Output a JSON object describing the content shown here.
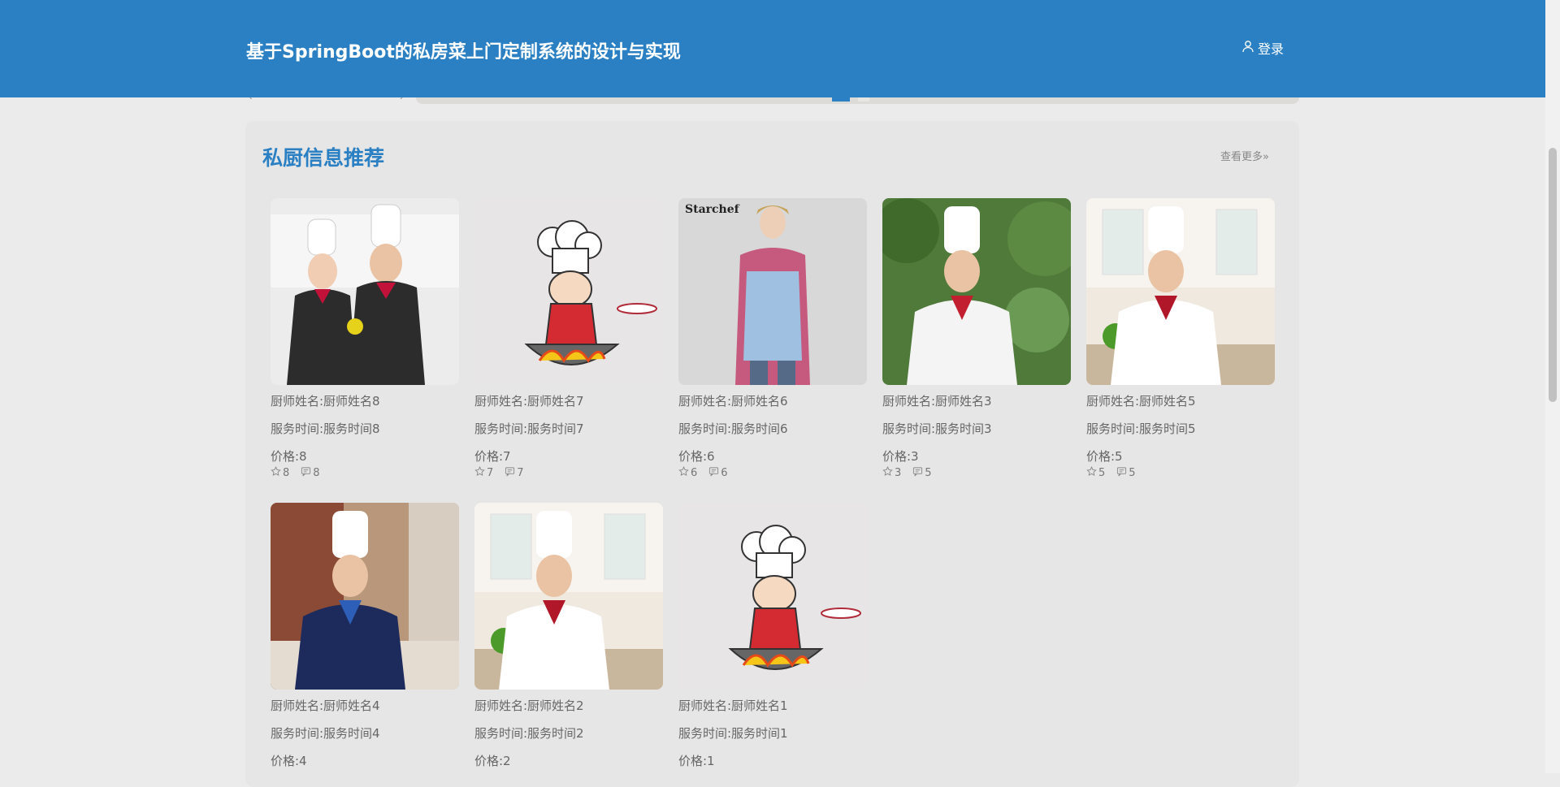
{
  "header": {
    "title": "基于SpringBoot的私房菜上门定制系统的设计与实现",
    "login_label": "登录"
  },
  "section": {
    "title": "私厨信息推荐",
    "more_label": "查看更多»"
  },
  "cards": [
    {
      "name": "厨师姓名:厨师姓名8",
      "time": "服务时间:服务时间8",
      "price": "价格:8",
      "likes": "8",
      "comments": "8",
      "image": "chef-couple-kitchen"
    },
    {
      "name": "厨师姓名:厨师姓名7",
      "time": "服务时间:服务时间7",
      "price": "价格:7",
      "likes": "7",
      "comments": "7",
      "image": "cartoon-chef-wok"
    },
    {
      "name": "厨师姓名:厨师姓名6",
      "time": "服务时间:服务时间6",
      "price": "价格:6",
      "likes": "6",
      "comments": "6",
      "image": "woman-denim-apron",
      "image_text": "Starchef"
    },
    {
      "name": "厨师姓名:厨师姓名3",
      "time": "服务时间:服务时间3",
      "price": "价格:3",
      "likes": "3",
      "comments": "5",
      "image": "chef-outdoor-trees"
    },
    {
      "name": "厨师姓名:厨师姓名5",
      "time": "服务时间:服务时间5",
      "price": "价格:5",
      "likes": "5",
      "comments": "5",
      "image": "chef-white-kitchen"
    },
    {
      "name": "厨师姓名:厨师姓名4",
      "time": "服务时间:服务时间4",
      "price": "价格:4",
      "image": "chef-navy-uniform"
    },
    {
      "name": "厨师姓名:厨师姓名2",
      "time": "服务时间:服务时间2",
      "price": "价格:2",
      "image": "chef-white-kitchen"
    },
    {
      "name": "厨师姓名:厨师姓名1",
      "time": "服务时间:服务时间1",
      "price": "价格:1",
      "image": "cartoon-chef-wok"
    }
  ],
  "colors": {
    "header": "#2a80c3",
    "accent": "#2a80c3",
    "background": "#ebebec"
  }
}
